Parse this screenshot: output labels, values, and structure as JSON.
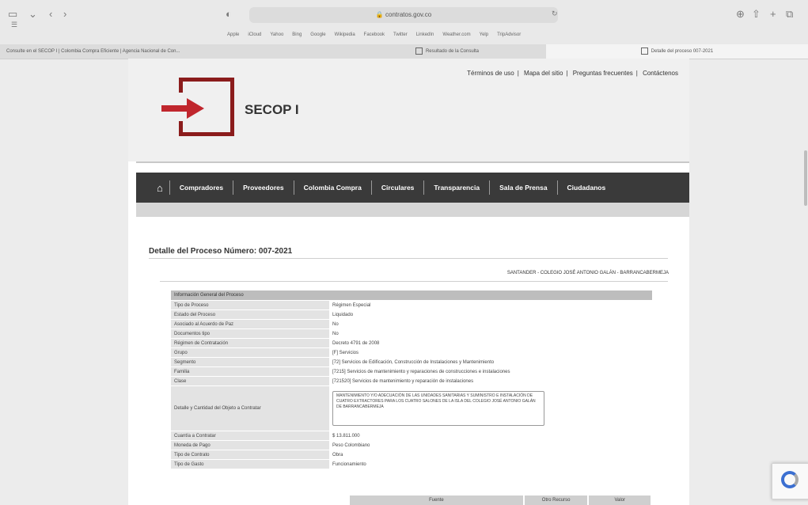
{
  "browser": {
    "address": "contratos.gov.co",
    "favorites": [
      "Apple",
      "iCloud",
      "Yahoo",
      "Bing",
      "Google",
      "Wikipedia",
      "Facebook",
      "Twitter",
      "LinkedIn",
      "Weather.com",
      "Yelp",
      "TripAdvisor"
    ],
    "tabs": [
      {
        "label": "Consulte en el SECOP I | Colombia Compra Eficiente | Agencia Nacional de Con..."
      },
      {
        "label": "Resultado de la Consulta"
      },
      {
        "label": "Detalle del proceso 007-2021"
      }
    ]
  },
  "site": {
    "top_links": [
      "Términos de uso",
      "Mapa del sitio",
      "Preguntas frecuentes",
      "Contáctenos"
    ],
    "logo_text": "SECOP I",
    "nav": [
      "Compradores",
      "Proveedores",
      "Colombia Compra",
      "Circulares",
      "Transparencia",
      "Sala de Prensa",
      "Ciudadanos"
    ]
  },
  "process": {
    "title": "Detalle del Proceso Número: 007-2021",
    "entity": "SANTANDER - COLEGIO JOSÉ ANTONIO GALÁN - BARRANCABERMEJA",
    "section_header": "Información General del Proceso",
    "rows": [
      {
        "label": "Tipo de Proceso",
        "value": "Régimen Especial"
      },
      {
        "label": "Estado del Proceso",
        "value": "Liquidado"
      },
      {
        "label": "Asociado al Acuerdo de Paz",
        "value": "No"
      },
      {
        "label": "Documentos tipo",
        "value": "No"
      },
      {
        "label": "Régimen de Contratación",
        "value": "Decreto 4791 de 2008"
      },
      {
        "label": "Grupo",
        "value": "[F] Servicios"
      },
      {
        "label": "Segmento",
        "value": "[72] Servicios de Edificación, Construcción de Instalaciones y Mantenimiento"
      },
      {
        "label": "Familia",
        "value": "[7215] Servicios de mantenimiento y reparaciones de construcciones e instalaciones"
      },
      {
        "label": "Clase",
        "value": "[721520] Servicios de mantenimiento y reparación de instalaciones"
      }
    ],
    "detail_label": "Detalle y Cantidad del Objeto a Contratar",
    "detail_value": "Mantenimiento y/o adecuación de las unidades sanitarias y suministro e instalación de cuatro extractores para los cuatro salones de la isla del Colegio José Antonio Galán de Barrancabermeja",
    "rows_after": [
      {
        "label": "Cuantía a Contratar",
        "value": "$ 13.811.000"
      },
      {
        "label": "Moneda de Pago",
        "value": "Peso Colombiano"
      },
      {
        "label": "Tipo de Contrato",
        "value": "Obra"
      },
      {
        "label": "Tipo de Gasto",
        "value": "Funcionamiento"
      }
    ],
    "bottom_columns": [
      "Fuente",
      "Otro Recurso",
      "Valor"
    ]
  }
}
